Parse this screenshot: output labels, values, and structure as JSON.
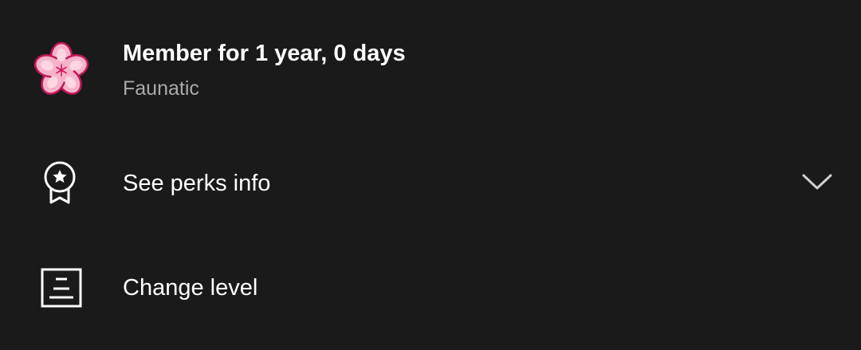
{
  "membership": {
    "badge_icon": "sakura-flower-badge-icon",
    "title": "Member for 1 year, 0 days",
    "level_name": "Faunatic"
  },
  "perks": {
    "icon": "award-ribbon-icon",
    "label": "See perks info",
    "toggle_icon": "chevron-down-icon"
  },
  "change_level": {
    "icon": "change-level-icon",
    "label": "Change level"
  },
  "colors": {
    "background": "#1a1a1a",
    "primary_text": "#ffffff",
    "secondary_text": "#aaaaaa",
    "badge_petal": "#f7a8c4",
    "badge_outline": "#c2185b"
  }
}
